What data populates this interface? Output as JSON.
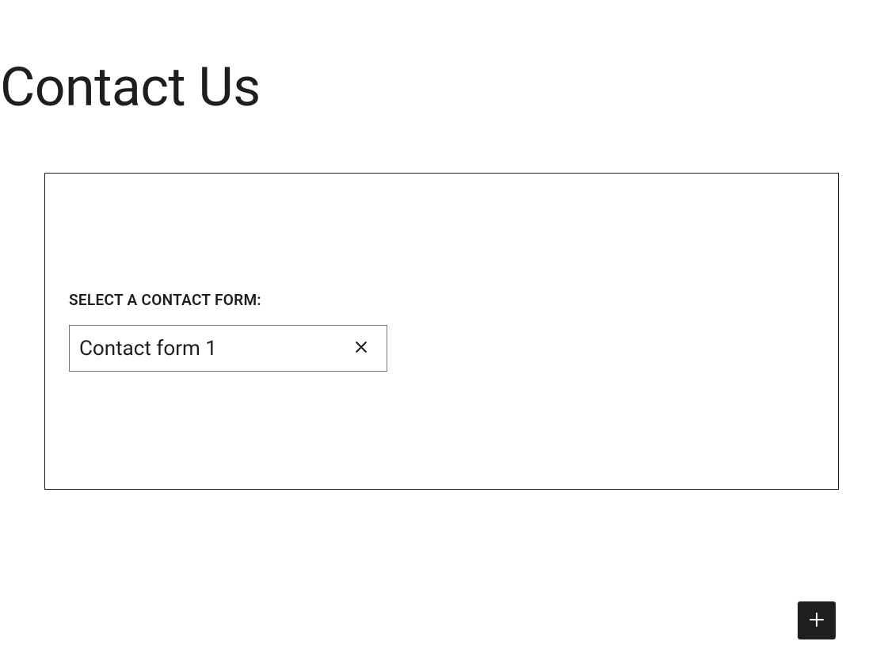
{
  "page": {
    "title": "Contact Us"
  },
  "block": {
    "label": "Select a contact form:",
    "selected": "Contact form 1"
  },
  "icons": {
    "close": "close-icon",
    "plus": "plus-icon"
  }
}
